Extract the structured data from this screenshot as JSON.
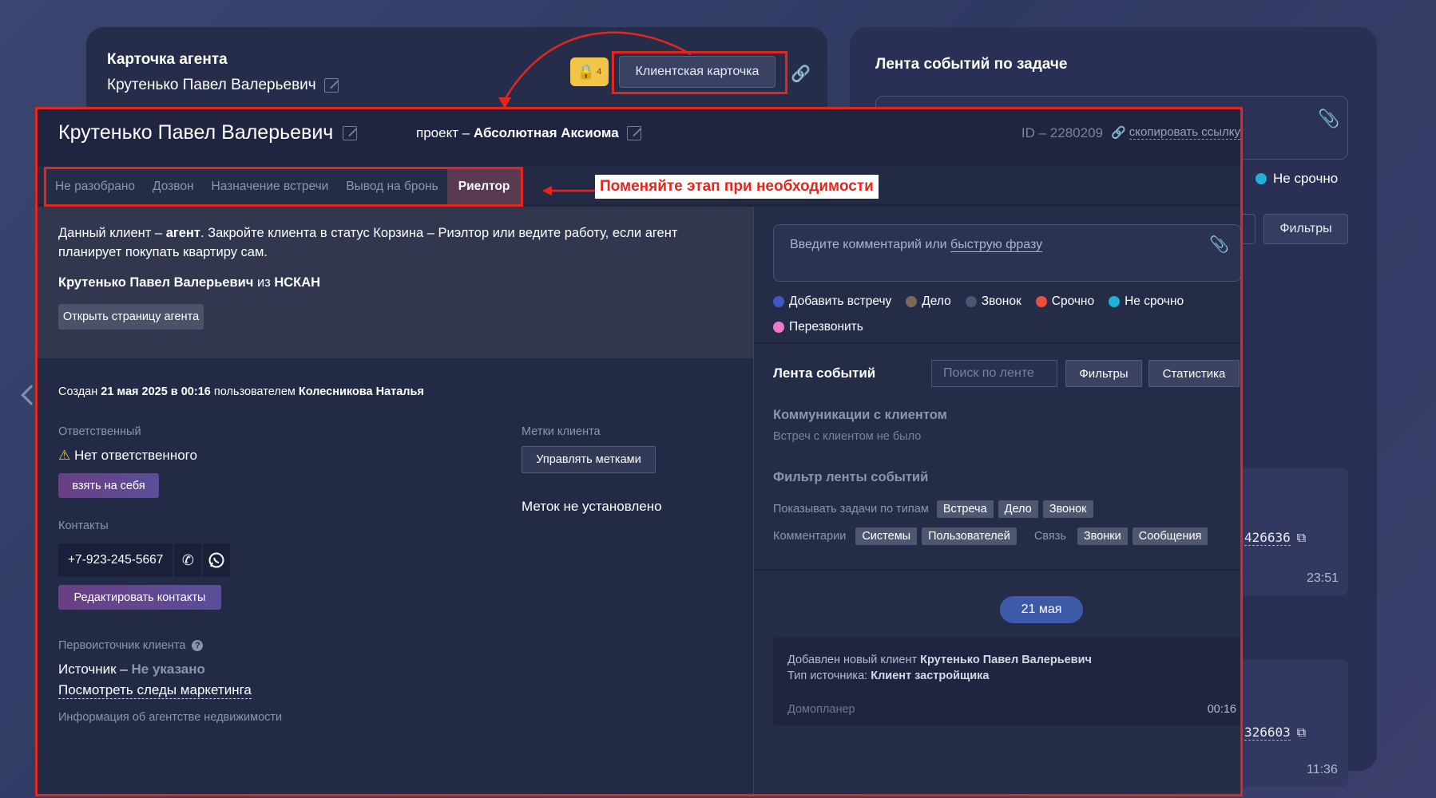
{
  "background": {
    "agent_card": {
      "title": "Карточка агента",
      "name": "Крутенько Павел Валерьевич"
    },
    "lock_count": "4",
    "client_card_button": "Клиентская карточка",
    "event_feed": {
      "title": "Лента событий по задаче",
      "not_urgent": "Не срочно",
      "filters": "Фильтры"
    },
    "items": [
      {
        "id": "426636",
        "time": "23:51"
      },
      {
        "id": "326603",
        "time": "11:36"
      }
    ]
  },
  "header": {
    "client_name": "Крутенько Павел Валерьевич",
    "project_prefix": "проект – ",
    "project_name": "Абсолютная Аксиома",
    "id_text": "ID – 2280209",
    "copy_link": "скопировать ссылку"
  },
  "stages": [
    {
      "label": "Не разобрано",
      "active": false
    },
    {
      "label": "Дозвон",
      "active": false
    },
    {
      "label": "Назначение встречи",
      "active": false
    },
    {
      "label": "Вывод на бронь",
      "active": false
    },
    {
      "label": "Риелтор",
      "active": true
    }
  ],
  "callout": "Поменяйте этап при необходимости",
  "agent_notice": {
    "part1": "Данный клиент – ",
    "bold": "агент",
    "part2": ". Закройте клиента в статус Корзина – Риэлтор или ведите работу, если агент планирует покупать квартиру сам.",
    "agent_name": "Крутенько Павел Валерьевич",
    "from_word": " из ",
    "agency": "НСКАН",
    "open_button": "Открыть страницу агента"
  },
  "created": {
    "prefix": "Создан ",
    "date": "21 мая 2025 в 00:16",
    "middle": " пользователем ",
    "user": "Колесникова Наталья"
  },
  "responsible": {
    "label": "Ответственный",
    "value": "Нет ответственного",
    "take_button": "взять на себя"
  },
  "tags_section": {
    "label": "Метки клиента",
    "manage_button": "Управлять метками",
    "empty": "Меток не установлено"
  },
  "contacts": {
    "label": "Контакты",
    "phone": "+7-923-245-5667",
    "edit_button": "Редактировать контакты"
  },
  "source": {
    "label": "Первоисточник клиента",
    "prefix": "Источник – ",
    "value": "Не указано",
    "marketing_link": "Посмотреть следы маркетинга",
    "agency_info": "Информация об агентстве недвижимости"
  },
  "comment": {
    "placeholder_prefix": "Введите комментарий или ",
    "placeholder_link": "быструю фразу"
  },
  "quick_tags": [
    {
      "label": "Добавить встречу",
      "color": "#3f56c4"
    },
    {
      "label": "Дело",
      "color": "#7a6a55"
    },
    {
      "label": "Звонок",
      "color": "#4b5675"
    },
    {
      "label": "Срочно",
      "color": "#e8503d"
    },
    {
      "label": "Не срочно",
      "color": "#1fb2d8"
    },
    {
      "label": "Перезвонить",
      "color": "#ee79c9"
    }
  ],
  "feed": {
    "title": "Лента событий",
    "search_placeholder": "Поиск по ленте",
    "filters": "Фильтры",
    "stats": "Статистика",
    "comm_title": "Коммуникации с клиентом",
    "comm_sub": "Встреч с клиентом не было",
    "filter_title": "Фильтр ленты событий",
    "types_label": "Показывать задачи по типам",
    "types": [
      "Встреча",
      "Дело",
      "Звонок"
    ],
    "comments_label": "Комментарии",
    "comments": [
      "Системы",
      "Пользователей"
    ],
    "link_label": "Связь",
    "links": [
      "Звонки",
      "Сообщения"
    ],
    "date_pill": "21 мая",
    "event": {
      "line1_prefix": "Добавлен новый клиент ",
      "line1_bold": "Крутенько Павел Валерьевич",
      "line2_prefix": "Тип источника: ",
      "line2_bold": "Клиент застройщика",
      "source": "Домопланер",
      "time": "00:16"
    }
  },
  "colors": {
    "accent_red": "#e5261d",
    "lock_yellow": "#f0c548",
    "purple_button": "#6a3f84",
    "date_pill": "#3d5aa8"
  }
}
